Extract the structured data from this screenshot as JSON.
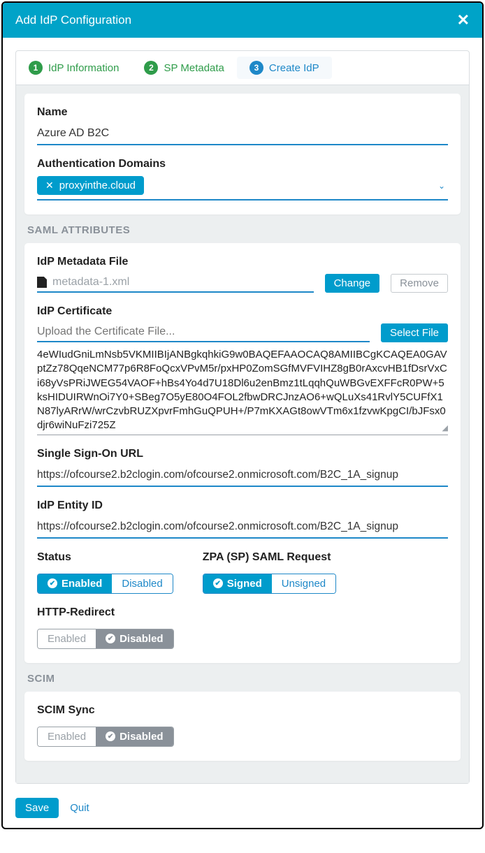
{
  "dialog": {
    "title": "Add IdP Configuration"
  },
  "steps": [
    {
      "num": "1",
      "label": "IdP Information"
    },
    {
      "num": "2",
      "label": "SP Metadata"
    },
    {
      "num": "3",
      "label": "Create IdP"
    }
  ],
  "fields": {
    "name_label": "Name",
    "name_value": "Azure AD B2C",
    "auth_domains_label": "Authentication Domains",
    "auth_domain_chip": "proxyinthe.cloud"
  },
  "sections": {
    "saml": "SAML ATTRIBUTES",
    "scim": "SCIM"
  },
  "saml": {
    "metadata_label": "IdP Metadata File",
    "metadata_filename": "metadata-1.xml",
    "change_btn": "Change",
    "remove_btn": "Remove",
    "cert_label": "IdP Certificate",
    "cert_placeholder": "Upload the Certificate File...",
    "select_file_btn": "Select File",
    "cert_text": "4eWIudGniLmNsb5VKMIIBIjANBgkqhkiG9w0BAQEFAAOCAQ8AMIIBCgKCAQEA0GAVptZz78QqeNCM77p6R8FoQcxVPvM5r/pxHP0ZomSGfMVFVIHZ8gB0rAxcvHB1fDsrVxCi68yVsPRiJWEG54VAOF+hBs4Yo4d7U18Dl6u2enBmz1tLqqhQuWBGvEXFFcR0PW+5ksHIDUIRWnOi7Y0+SBeg7O5yE80O4FOL2fbwDRCJnzAO6+wQLuXs41RvlY5CUFfX1N87lyARrW/wrCzvbRUZXpvrFmhGuQPUH+/P7mKXAGt8owVTm6x1fzvwKpgCI/bJFsx0djr6wiNuFzi725Z",
    "sso_url_label": "Single Sign-On URL",
    "sso_url_value": "https://ofcourse2.b2clogin.com/ofcourse2.onmicrosoft.com/B2C_1A_signup",
    "entity_id_label": "IdP Entity ID",
    "entity_id_value": "https://ofcourse2.b2clogin.com/ofcourse2.onmicrosoft.com/B2C_1A_signup",
    "status_label": "Status",
    "status_enabled": "Enabled",
    "status_disabled": "Disabled",
    "saml_req_label": "ZPA (SP) SAML Request",
    "saml_req_signed": "Signed",
    "saml_req_unsigned": "Unsigned",
    "http_redirect_label": "HTTP-Redirect",
    "http_redirect_enabled": "Enabled",
    "http_redirect_disabled": "Disabled"
  },
  "scim": {
    "sync_label": "SCIM Sync",
    "sync_enabled": "Enabled",
    "sync_disabled": "Disabled"
  },
  "footer": {
    "save": "Save",
    "quit": "Quit"
  }
}
